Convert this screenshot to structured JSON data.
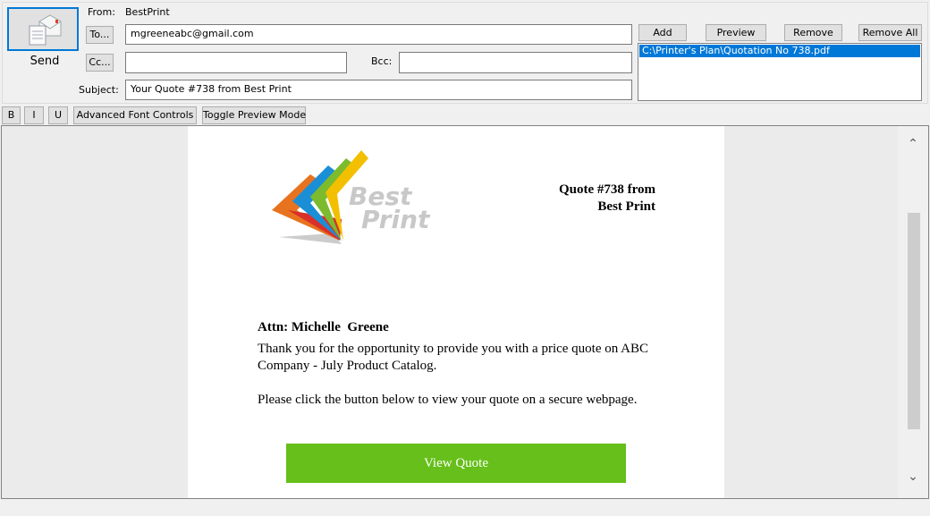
{
  "header": {
    "send_label": "Send",
    "from_label": "From:",
    "from_value": "BestPrint",
    "to_button": "To...",
    "to_value": "mgreeneabc@gmail.com",
    "cc_button": "Cc...",
    "cc_value": "",
    "bcc_label": "Bcc:",
    "bcc_value": "",
    "subject_label": "Subject:",
    "subject_value": "Your Quote #738 from Best Print"
  },
  "attachments": {
    "add": "Add",
    "preview": "Preview",
    "remove": "Remove",
    "remove_all": "Remove All",
    "items": [
      "C:\\Printer's Plan\\Quotation No 738.pdf"
    ]
  },
  "toolbar": {
    "bold": "B",
    "italic": "I",
    "underline": "U",
    "advanced": "Advanced Font Controls",
    "toggle_preview": "Toggle Preview Mode"
  },
  "email": {
    "logo_text_1": "Best",
    "logo_text_2": "Print",
    "title_line1": "Quote #738 from",
    "title_line2": "Best Print",
    "attn": "Attn: Michelle  Greene",
    "para1": "Thank you for the opportunity to provide you with a price quote on ABC Company - July Product Catalog.",
    "para2": "Please click the button below to view your quote on a secure webpage.",
    "cta": "View Quote",
    "cta_color": "#66bf1a"
  }
}
